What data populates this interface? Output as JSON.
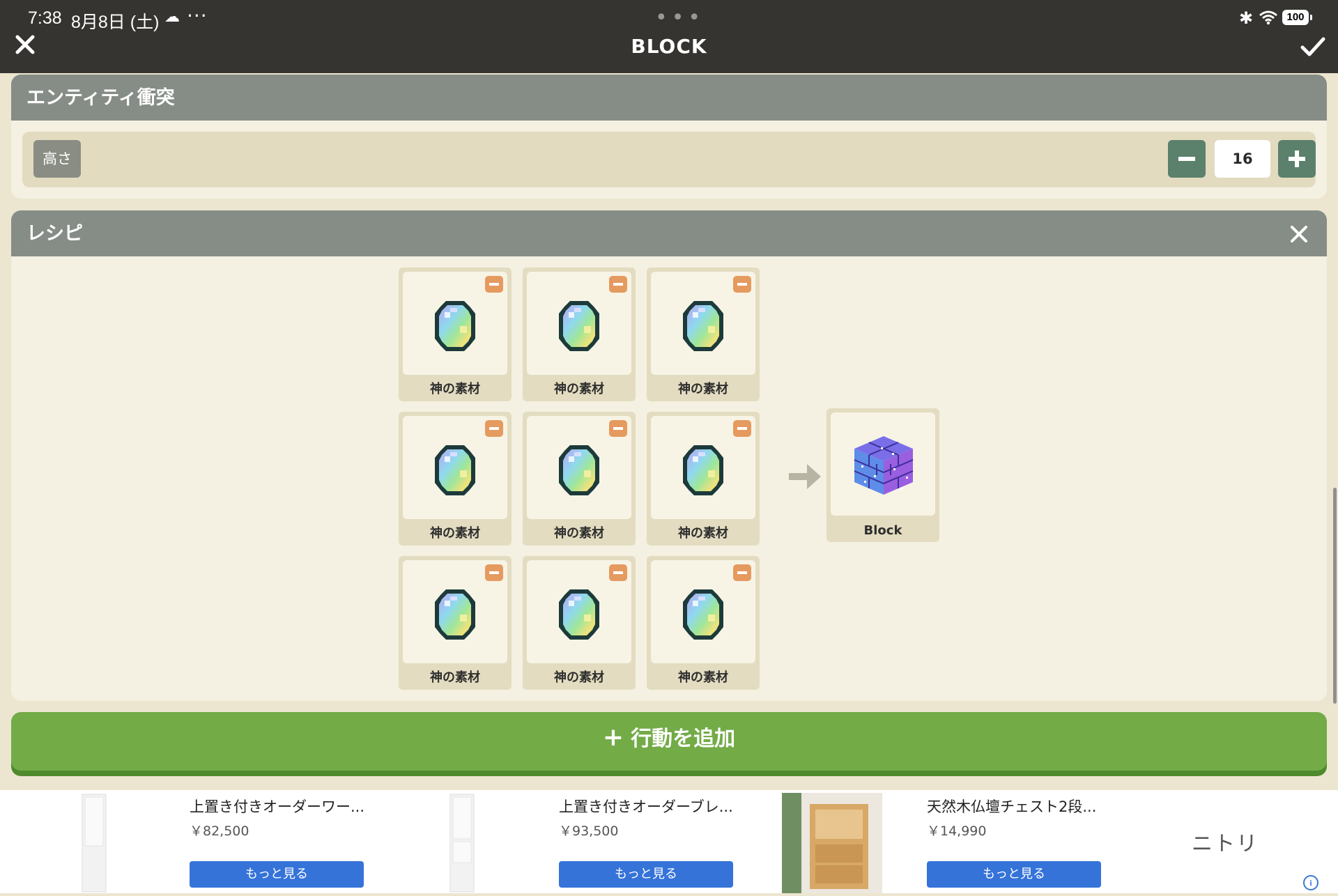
{
  "status_bar": {
    "time": "7:38",
    "date": "8月8日 (土)",
    "more": "···",
    "battery": "100"
  },
  "header": {
    "title": "BLOCK"
  },
  "entity_panel": {
    "title": "エンティティ衝突",
    "height_label": "高さ",
    "height_value": "16"
  },
  "recipe_panel": {
    "title": "レシピ",
    "ingredients": [
      {
        "label": "神の素材"
      },
      {
        "label": "神の素材"
      },
      {
        "label": "神の素材"
      },
      {
        "label": "神の素材"
      },
      {
        "label": "神の素材"
      },
      {
        "label": "神の素材"
      },
      {
        "label": "神の素材"
      },
      {
        "label": "神の素材"
      },
      {
        "label": "神の素材"
      }
    ],
    "result": {
      "label": "Block"
    }
  },
  "add_action": {
    "label": "行動を追加"
  },
  "ads": {
    "items": [
      {
        "title": "上置き付きオーダーワー...",
        "price": "￥82,500",
        "button": "もっと見る"
      },
      {
        "title": "上置き付きオーダーブレ...",
        "price": "￥93,500",
        "button": "もっと見る"
      },
      {
        "title": "天然木仏壇チェスト2段...",
        "price": "￥14,990",
        "button": "もっと見る"
      }
    ],
    "brand": "ニトリ",
    "info": "i"
  }
}
